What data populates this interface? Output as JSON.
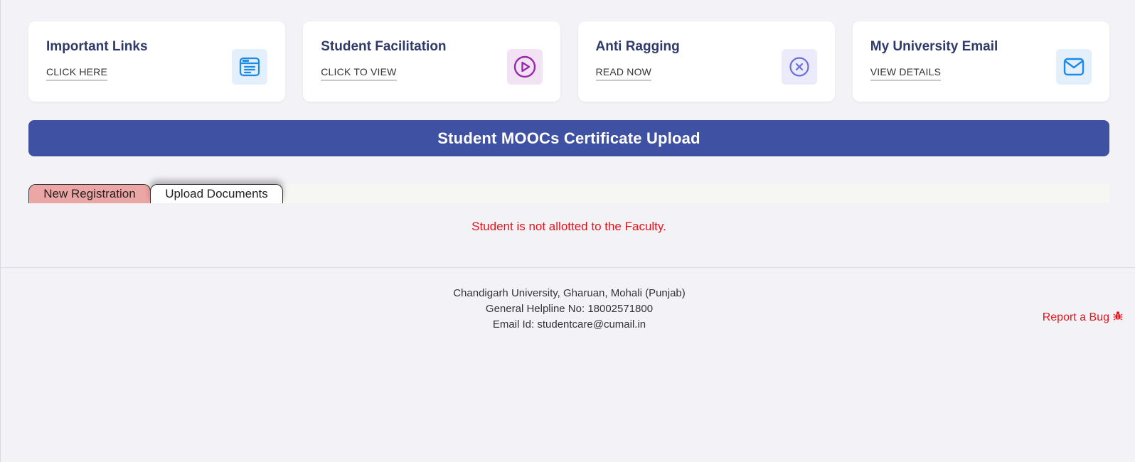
{
  "cards": [
    {
      "title": "Important Links",
      "link": "CLICK HERE",
      "icon": "browser-window-icon"
    },
    {
      "title": "Student Facilitation",
      "link": "CLICK TO VIEW",
      "icon": "play-circle-icon"
    },
    {
      "title": "Anti Ragging",
      "link": "READ NOW",
      "icon": "close-circle-icon"
    },
    {
      "title": "My University Email",
      "link": "VIEW DETAILS",
      "icon": "envelope-icon"
    }
  ],
  "banner": {
    "title": "Student MOOCs Certificate Upload"
  },
  "tabs": [
    {
      "label": "New Registration"
    },
    {
      "label": "Upload Documents"
    }
  ],
  "message": {
    "error": "Student is not allotted to the Faculty."
  },
  "footer": {
    "address": "Chandigarh University, Gharuan, Mohali (Punjab)",
    "helpline": "General Helpline No: 18002571800",
    "email": "Email Id: studentcare@cumail.in",
    "report_bug": "Report a Bug"
  },
  "colors": {
    "banner": "#3f51a3",
    "card_title": "#2f3a6b",
    "error": "#e4141b",
    "active_tab": "#eda6a6",
    "icon_blue": "#1a8be8",
    "icon_purple": "#9c27b0",
    "icon_indigo": "#6b6fd8"
  }
}
